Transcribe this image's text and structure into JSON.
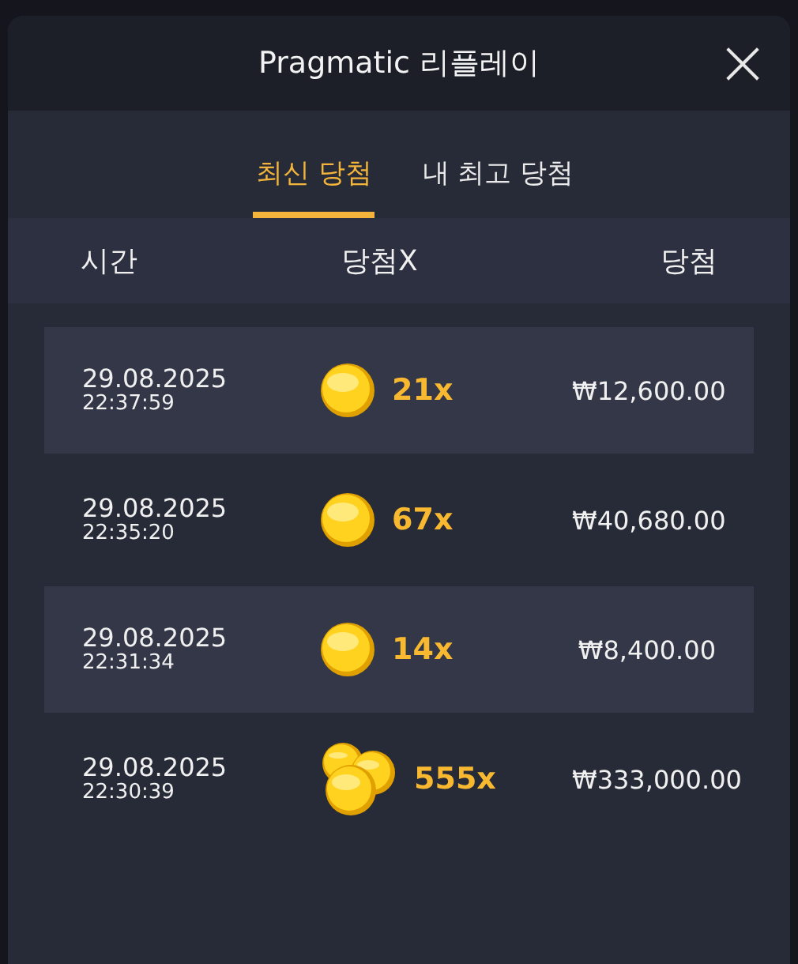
{
  "dialog": {
    "title": "Pragmatic 리플레이",
    "close": "×"
  },
  "tabs": [
    {
      "label": "최신 당첨",
      "selected": true
    },
    {
      "label": "내 최고 당첨",
      "selected": false
    }
  ],
  "columns": [
    "시간",
    "당첨X",
    "당첨"
  ],
  "rows": [
    {
      "date": "29.08.2025",
      "time": "22:37:59",
      "kind": "coin",
      "multiplier": "21x",
      "win": "₩12,600.00"
    },
    {
      "date": "29.08.2025",
      "time": "22:35:20",
      "kind": "coin",
      "multiplier": "67x",
      "win": "₩40,680.00"
    },
    {
      "date": "29.08.2025",
      "time": "22:31:34",
      "kind": "coin",
      "multiplier": "14x",
      "win": "₩8,400.00"
    },
    {
      "date": "29.08.2025",
      "time": "22:30:39",
      "kind": "coins",
      "multiplier": "555x",
      "win": "₩333,000.00"
    }
  ]
}
